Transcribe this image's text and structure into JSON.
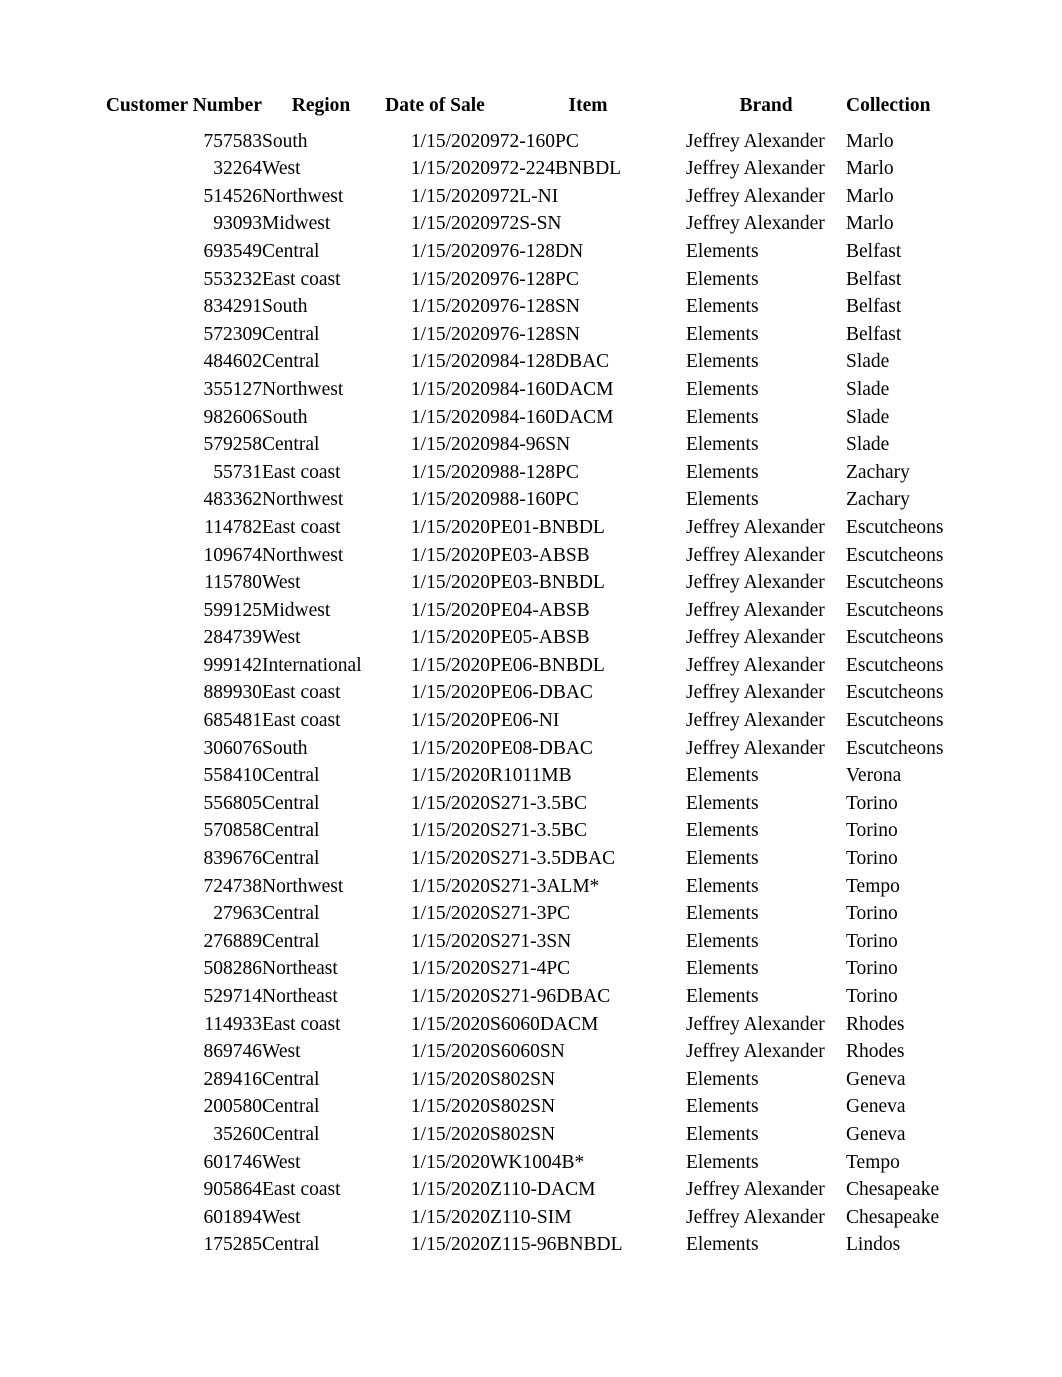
{
  "table": {
    "headers": [
      "Customer Number",
      "Region",
      "Date of Sale",
      "Item",
      "Brand",
      "Collection"
    ],
    "rows": [
      [
        "757583",
        "South",
        "1/15/2020",
        "972-160PC",
        "Jeffrey Alexander",
        "Marlo"
      ],
      [
        "32264",
        "West",
        "1/15/2020",
        "972-224BNBDL",
        "Jeffrey Alexander",
        "Marlo"
      ],
      [
        "514526",
        "Northwest",
        "1/15/2020",
        "972L-NI",
        "Jeffrey Alexander",
        "Marlo"
      ],
      [
        "93093",
        "Midwest",
        "1/15/2020",
        "972S-SN",
        "Jeffrey Alexander",
        "Marlo"
      ],
      [
        "693549",
        "Central",
        "1/15/2020",
        "976-128DN",
        "Elements",
        "Belfast"
      ],
      [
        "553232",
        "East coast",
        "1/15/2020",
        "976-128PC",
        "Elements",
        "Belfast"
      ],
      [
        "834291",
        "South",
        "1/15/2020",
        "976-128SN",
        "Elements",
        "Belfast"
      ],
      [
        "572309",
        "Central",
        "1/15/2020",
        "976-128SN",
        "Elements",
        "Belfast"
      ],
      [
        "484602",
        "Central",
        "1/15/2020",
        "984-128DBAC",
        "Elements",
        "Slade"
      ],
      [
        "355127",
        "Northwest",
        "1/15/2020",
        "984-160DACM",
        "Elements",
        "Slade"
      ],
      [
        "982606",
        "South",
        "1/15/2020",
        "984-160DACM",
        "Elements",
        "Slade"
      ],
      [
        "579258",
        "Central",
        "1/15/2020",
        "984-96SN",
        "Elements",
        "Slade"
      ],
      [
        "55731",
        "East coast",
        "1/15/2020",
        "988-128PC",
        "Elements",
        "Zachary"
      ],
      [
        "483362",
        "Northwest",
        "1/15/2020",
        "988-160PC",
        "Elements",
        "Zachary"
      ],
      [
        "114782",
        "East coast",
        "1/15/2020",
        "PE01-BNBDL",
        "Jeffrey Alexander",
        "Escutcheons"
      ],
      [
        "109674",
        "Northwest",
        "1/15/2020",
        "PE03-ABSB",
        "Jeffrey Alexander",
        "Escutcheons"
      ],
      [
        "115780",
        "West",
        "1/15/2020",
        "PE03-BNBDL",
        "Jeffrey Alexander",
        "Escutcheons"
      ],
      [
        "599125",
        "Midwest",
        "1/15/2020",
        "PE04-ABSB",
        "Jeffrey Alexander",
        "Escutcheons"
      ],
      [
        "284739",
        "West",
        "1/15/2020",
        "PE05-ABSB",
        "Jeffrey Alexander",
        "Escutcheons"
      ],
      [
        "999142",
        "International",
        "1/15/2020",
        "PE06-BNBDL",
        "Jeffrey Alexander",
        "Escutcheons"
      ],
      [
        "889930",
        "East coast",
        "1/15/2020",
        "PE06-DBAC",
        "Jeffrey Alexander",
        "Escutcheons"
      ],
      [
        "685481",
        "East coast",
        "1/15/2020",
        "PE06-NI",
        "Jeffrey Alexander",
        "Escutcheons"
      ],
      [
        "306076",
        "South",
        "1/15/2020",
        "PE08-DBAC",
        "Jeffrey Alexander",
        "Escutcheons"
      ],
      [
        "558410",
        "Central",
        "1/15/2020",
        "R1011MB",
        "Elements",
        "Verona"
      ],
      [
        "556805",
        "Central",
        "1/15/2020",
        "S271-3.5BC",
        "Elements",
        "Torino"
      ],
      [
        "570858",
        "Central",
        "1/15/2020",
        "S271-3.5BC",
        "Elements",
        "Torino"
      ],
      [
        "839676",
        "Central",
        "1/15/2020",
        "S271-3.5DBAC",
        "Elements",
        "Torino"
      ],
      [
        "724738",
        "Northwest",
        "1/15/2020",
        "S271-3ALM*",
        "Elements",
        "Tempo"
      ],
      [
        "27963",
        "Central",
        "1/15/2020",
        "S271-3PC",
        "Elements",
        "Torino"
      ],
      [
        "276889",
        "Central",
        "1/15/2020",
        "S271-3SN",
        "Elements",
        "Torino"
      ],
      [
        "508286",
        "Northeast",
        "1/15/2020",
        "S271-4PC",
        "Elements",
        "Torino"
      ],
      [
        "529714",
        "Northeast",
        "1/15/2020",
        "S271-96DBAC",
        "Elements",
        "Torino"
      ],
      [
        "114933",
        "East coast",
        "1/15/2020",
        "S6060DACM",
        "Jeffrey Alexander",
        "Rhodes"
      ],
      [
        "869746",
        "West",
        "1/15/2020",
        "S6060SN",
        "Jeffrey Alexander",
        "Rhodes"
      ],
      [
        "289416",
        "Central",
        "1/15/2020",
        "S802SN",
        "Elements",
        "Geneva"
      ],
      [
        "200580",
        "Central",
        "1/15/2020",
        "S802SN",
        "Elements",
        "Geneva"
      ],
      [
        "35260",
        "Central",
        "1/15/2020",
        "S802SN",
        "Elements",
        "Geneva"
      ],
      [
        "601746",
        "West",
        "1/15/2020",
        "WK1004B*",
        "Elements",
        "Tempo"
      ],
      [
        "905864",
        "East coast",
        "1/15/2020",
        "Z110-DACM",
        "Jeffrey Alexander",
        "Chesapeake"
      ],
      [
        "601894",
        "West",
        "1/15/2020",
        "Z110-SIM",
        "Jeffrey Alexander",
        "Chesapeake"
      ],
      [
        "175285",
        "Central",
        "1/15/2020",
        "Z115-96BNBDL",
        "Elements",
        "Lindos"
      ]
    ]
  }
}
